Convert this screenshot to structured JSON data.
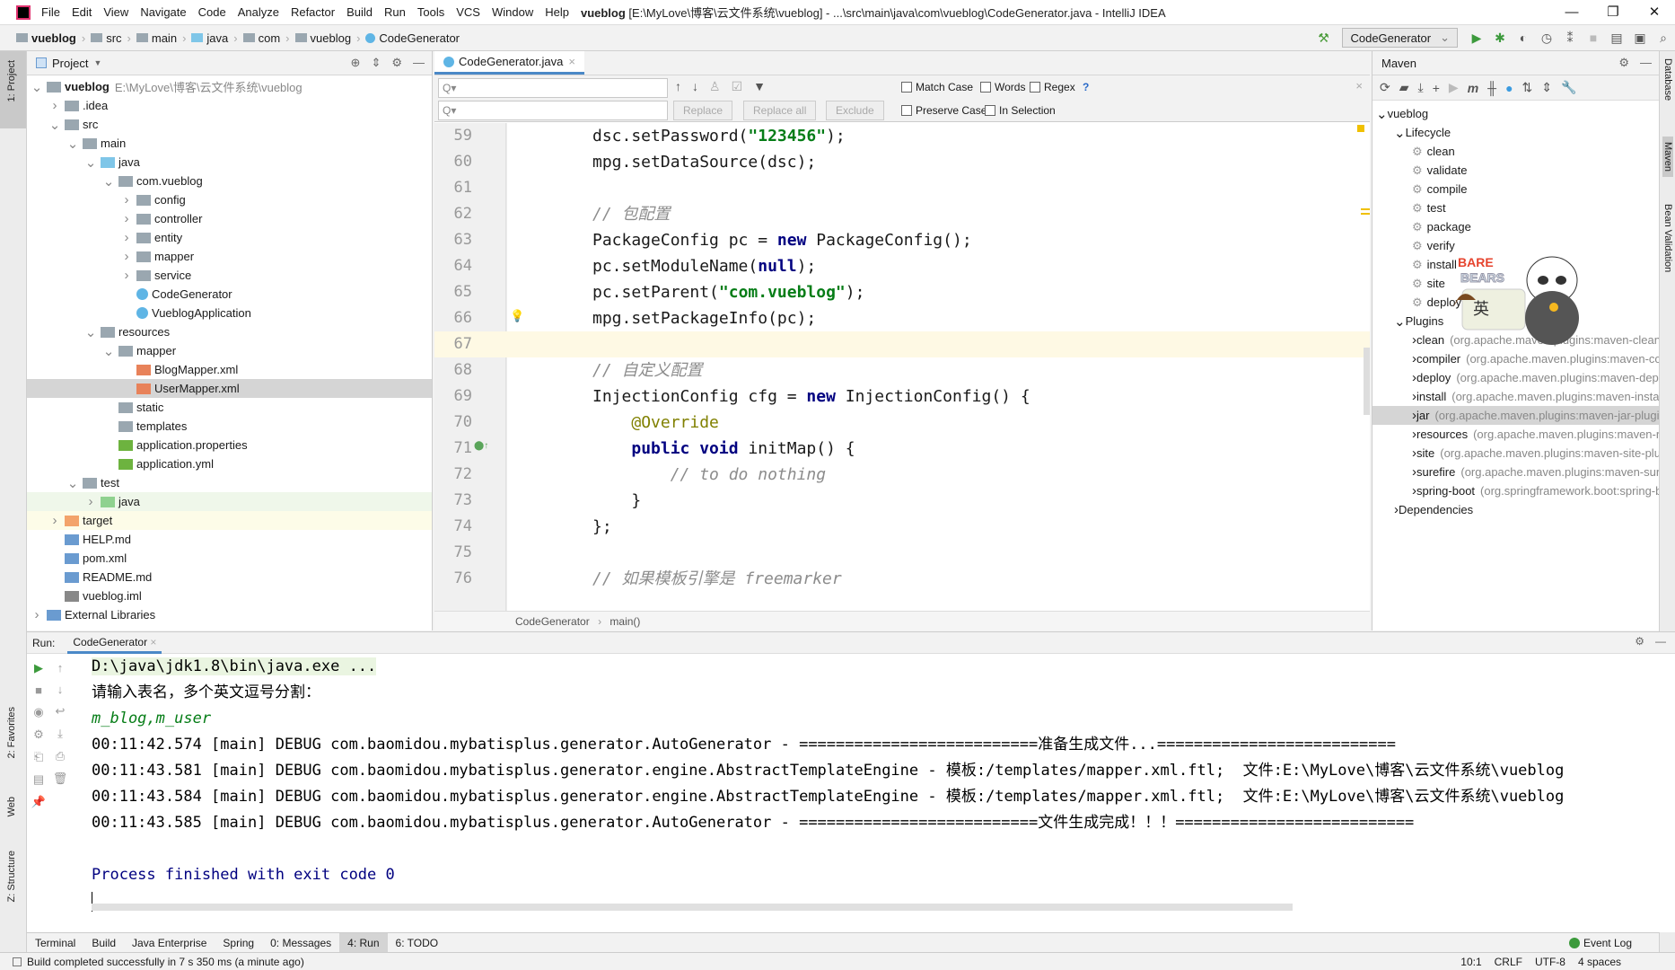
{
  "titlebar": {
    "menu": [
      "File",
      "Edit",
      "View",
      "Navigate",
      "Code",
      "Analyze",
      "Refactor",
      "Build",
      "Run",
      "Tools",
      "VCS",
      "Window",
      "Help"
    ],
    "project": "vueblog",
    "title_rest": " [E:\\MyLove\\博客\\云文件系统\\vueblog] - ...\\src\\main\\java\\com\\vueblog\\CodeGenerator.java - IntelliJ IDEA",
    "controls": [
      "—",
      "❐",
      "✕"
    ]
  },
  "navbar": {
    "crumbs": [
      "vueblog",
      "src",
      "main",
      "java",
      "com",
      "vueblog",
      "CodeGenerator"
    ],
    "run_config": "CodeGenerator"
  },
  "leftstrip": {
    "project": "1: Project",
    "favorites": "2: Favorites",
    "web": "Web",
    "structure": "Z: Structure"
  },
  "rightstrip": {
    "database": "Database",
    "maven": "Maven",
    "bean": "Bean Validation"
  },
  "project": {
    "header": "Project",
    "tree": [
      {
        "label": "vueblog",
        "extra": "E:\\MyLove\\博客\\云文件系统\\vueblog",
        "depth": 0,
        "arrow": "v",
        "icon": "module-folder",
        "bold": true
      },
      {
        "label": ".idea",
        "depth": 1,
        "arrow": ">",
        "icon": "folder"
      },
      {
        "label": "src",
        "depth": 1,
        "arrow": "v",
        "icon": "folder"
      },
      {
        "label": "main",
        "depth": 2,
        "arrow": "v",
        "icon": "folder"
      },
      {
        "label": "java",
        "depth": 3,
        "arrow": "v",
        "icon": "source-folder"
      },
      {
        "label": "com.vueblog",
        "depth": 4,
        "arrow": "v",
        "icon": "package"
      },
      {
        "label": "config",
        "depth": 5,
        "arrow": ">",
        "icon": "package"
      },
      {
        "label": "controller",
        "depth": 5,
        "arrow": ">",
        "icon": "package"
      },
      {
        "label": "entity",
        "depth": 5,
        "arrow": ">",
        "icon": "package"
      },
      {
        "label": "mapper",
        "depth": 5,
        "arrow": ">",
        "icon": "package"
      },
      {
        "label": "service",
        "depth": 5,
        "arrow": ">",
        "icon": "package"
      },
      {
        "label": "CodeGenerator",
        "depth": 5,
        "arrow": "",
        "icon": "java-class"
      },
      {
        "label": "VueblogApplication",
        "depth": 5,
        "arrow": "",
        "icon": "java-class"
      },
      {
        "label": "resources",
        "depth": 3,
        "arrow": "v",
        "icon": "resources-folder"
      },
      {
        "label": "mapper",
        "depth": 4,
        "arrow": "v",
        "icon": "package"
      },
      {
        "label": "BlogMapper.xml",
        "depth": 5,
        "arrow": "",
        "icon": "xml-file"
      },
      {
        "label": "UserMapper.xml",
        "depth": 5,
        "arrow": "",
        "icon": "xml-file",
        "state": "selected"
      },
      {
        "label": "static",
        "depth": 4,
        "arrow": "",
        "icon": "package"
      },
      {
        "label": "templates",
        "depth": 4,
        "arrow": "",
        "icon": "package"
      },
      {
        "label": "application.properties",
        "depth": 4,
        "arrow": "",
        "icon": "spring-config"
      },
      {
        "label": "application.yml",
        "depth": 4,
        "arrow": "",
        "icon": "spring-config"
      },
      {
        "label": "test",
        "depth": 2,
        "arrow": "v",
        "icon": "folder"
      },
      {
        "label": "java",
        "depth": 3,
        "arrow": ">",
        "icon": "test-folder",
        "state": "green"
      },
      {
        "label": "target",
        "depth": 1,
        "arrow": ">",
        "icon": "excluded-folder",
        "state": "yellow"
      },
      {
        "label": "HELP.md",
        "depth": 1,
        "arrow": "",
        "icon": "md-file"
      },
      {
        "label": "pom.xml",
        "depth": 1,
        "arrow": "",
        "icon": "maven-file"
      },
      {
        "label": "README.md",
        "depth": 1,
        "arrow": "",
        "icon": "md-file"
      },
      {
        "label": "vueblog.iml",
        "depth": 1,
        "arrow": "",
        "icon": "iml-file"
      },
      {
        "label": "External Libraries",
        "depth": 0,
        "arrow": ">",
        "icon": "libraries"
      }
    ]
  },
  "editor": {
    "tab": "CodeGenerator.java",
    "find": {
      "match_case": "Match Case",
      "words": "Words",
      "regex": "Regex",
      "help": "?",
      "preserve_case": "Preserve Case",
      "in_selection": "In Selection",
      "replace": "Replace",
      "replace_all": "Replace all",
      "exclude": "Exclude"
    },
    "current_line": 67,
    "lines": [
      {
        "n": "59",
        "seg": [
          [
            "dsc.setPassword(",
            ""
          ],
          [
            "\"123456\"",
            "str"
          ],
          [
            ");",
            ""
          ]
        ]
      },
      {
        "n": "60",
        "seg": [
          [
            "mpg.setDataSource(dsc);",
            ""
          ]
        ]
      },
      {
        "n": "61",
        "seg": []
      },
      {
        "n": "62",
        "seg": [
          [
            "// 包配置",
            "cmt"
          ]
        ]
      },
      {
        "n": "63",
        "seg": [
          [
            "PackageConfig pc = ",
            ""
          ],
          [
            "new",
            "kw"
          ],
          [
            " PackageConfig();",
            ""
          ]
        ]
      },
      {
        "n": "64",
        "seg": [
          [
            "pc.setModuleName(",
            ""
          ],
          [
            "null",
            "kw"
          ],
          [
            ");",
            ""
          ]
        ]
      },
      {
        "n": "65",
        "seg": [
          [
            "pc.setParent(",
            ""
          ],
          [
            "\"com.vueblog\"",
            "str"
          ],
          [
            ");",
            ""
          ]
        ]
      },
      {
        "n": "66",
        "seg": [
          [
            "mpg.setPackageInfo(pc);",
            ""
          ]
        ]
      },
      {
        "n": "67",
        "seg": []
      },
      {
        "n": "68",
        "seg": [
          [
            "// 自定义配置",
            "cmt"
          ]
        ]
      },
      {
        "n": "69",
        "seg": [
          [
            "InjectionConfig cfg = ",
            ""
          ],
          [
            "new",
            "kw"
          ],
          [
            " InjectionConfig() {",
            ""
          ]
        ]
      },
      {
        "n": "70",
        "seg": [
          [
            "    ",
            ""
          ],
          [
            "@Override",
            "ann"
          ]
        ]
      },
      {
        "n": "71",
        "seg": [
          [
            "    ",
            ""
          ],
          [
            "public void",
            "kw"
          ],
          [
            " initMap() {",
            ""
          ]
        ]
      },
      {
        "n": "72",
        "seg": [
          [
            "        ",
            ""
          ],
          [
            "// to do nothing",
            "cmt"
          ]
        ]
      },
      {
        "n": "73",
        "seg": [
          [
            "    }",
            ""
          ]
        ]
      },
      {
        "n": "74",
        "seg": [
          [
            "};",
            ""
          ]
        ]
      },
      {
        "n": "75",
        "seg": []
      },
      {
        "n": "76",
        "seg": [
          [
            "// 如果模板引擎是 freemarker",
            "cmt"
          ]
        ]
      }
    ],
    "breadcrumb": [
      "CodeGenerator",
      "main()"
    ]
  },
  "maven": {
    "header": "Maven",
    "tree": [
      {
        "label": "vueblog",
        "depth": 0,
        "arrow": "v",
        "icon": "maven-project"
      },
      {
        "label": "Lifecycle",
        "depth": 1,
        "arrow": "v",
        "icon": "lifecycle-folder"
      },
      {
        "label": "clean",
        "depth": 2,
        "icon": "gear"
      },
      {
        "label": "validate",
        "depth": 2,
        "icon": "gear"
      },
      {
        "label": "compile",
        "depth": 2,
        "icon": "gear"
      },
      {
        "label": "test",
        "depth": 2,
        "icon": "gear"
      },
      {
        "label": "package",
        "depth": 2,
        "icon": "gear"
      },
      {
        "label": "verify",
        "depth": 2,
        "icon": "gear"
      },
      {
        "label": "install",
        "depth": 2,
        "icon": "gear"
      },
      {
        "label": "site",
        "depth": 2,
        "icon": "gear"
      },
      {
        "label": "deploy",
        "depth": 2,
        "icon": "gear"
      },
      {
        "label": "Plugins",
        "depth": 1,
        "arrow": "v",
        "icon": "plugins-folder"
      },
      {
        "label": "clean",
        "extra": "(org.apache.maven.plugins:maven-clean-plugin)",
        "depth": 2,
        "arrow": ">",
        "icon": "plugin"
      },
      {
        "label": "compiler",
        "extra": "(org.apache.maven.plugins:maven-compiler-plugin)",
        "depth": 2,
        "arrow": ">",
        "icon": "plugin"
      },
      {
        "label": "deploy",
        "extra": "(org.apache.maven.plugins:maven-deploy-plugin)",
        "depth": 2,
        "arrow": ">",
        "icon": "plugin"
      },
      {
        "label": "install",
        "extra": "(org.apache.maven.plugins:maven-install-plugin)",
        "depth": 2,
        "arrow": ">",
        "icon": "plugin"
      },
      {
        "label": "jar",
        "extra": "(org.apache.maven.plugins:maven-jar-plugin)",
        "depth": 2,
        "arrow": ">",
        "icon": "plugin",
        "state": "selected"
      },
      {
        "label": "resources",
        "extra": "(org.apache.maven.plugins:maven-resources-plugin)",
        "depth": 2,
        "arrow": ">",
        "icon": "plugin"
      },
      {
        "label": "site",
        "extra": "(org.apache.maven.plugins:maven-site-plugin)",
        "depth": 2,
        "arrow": ">",
        "icon": "plugin"
      },
      {
        "label": "surefire",
        "extra": "(org.apache.maven.plugins:maven-surefire-plugin)",
        "depth": 2,
        "arrow": ">",
        "icon": "plugin"
      },
      {
        "label": "spring-boot",
        "extra": "(org.springframework.boot:spring-boot-maven-plugin)",
        "depth": 2,
        "arrow": ">",
        "icon": "plugin"
      },
      {
        "label": "Dependencies",
        "depth": 1,
        "arrow": ">",
        "icon": "dependencies"
      }
    ],
    "sticker_logo": "We BARE BEARS",
    "sticker_ime": "英"
  },
  "run": {
    "label": "Run:",
    "tab": "CodeGenerator",
    "console": [
      {
        "text": "D:\\java\\jdk1.8\\bin\\java.exe ...",
        "kind": "cmd"
      },
      {
        "text": "请输入表名，多个英文逗号分割：",
        "kind": "out"
      },
      {
        "text": "m_blog,m_user",
        "kind": "input"
      },
      {
        "text": "00:11:42.574 [main] DEBUG com.baomidou.mybatisplus.generator.AutoGenerator - ==========================准备生成文件...==========================",
        "kind": "out"
      },
      {
        "text": "00:11:43.581 [main] DEBUG com.baomidou.mybatisplus.generator.engine.AbstractTemplateEngine - 模板:/templates/mapper.xml.ftl;  文件:E:\\MyLove\\博客\\云文件系统\\vueblog",
        "kind": "out"
      },
      {
        "text": "00:11:43.584 [main] DEBUG com.baomidou.mybatisplus.generator.engine.AbstractTemplateEngine - 模板:/templates/mapper.xml.ftl;  文件:E:\\MyLove\\博客\\云文件系统\\vueblog",
        "kind": "out"
      },
      {
        "text": "00:11:43.585 [main] DEBUG com.baomidou.mybatisplus.generator.AutoGenerator - ==========================文件生成完成！！！==========================",
        "kind": "out"
      },
      {
        "text": "",
        "kind": "out"
      },
      {
        "text": "Process finished with exit code 0",
        "kind": "proc"
      }
    ]
  },
  "toolwindows": [
    "Terminal",
    "Build",
    "Java Enterprise",
    "Spring",
    "0: Messages",
    "4: Run",
    "6: TODO"
  ],
  "active_toolwindow": "4: Run",
  "event_log": "Event Log",
  "status": {
    "message": "Build completed successfully in 7 s 350 ms (a minute ago)",
    "position": "10:1",
    "line_sep": "CRLF",
    "encoding": "UTF-8",
    "indent": "4 spaces"
  }
}
